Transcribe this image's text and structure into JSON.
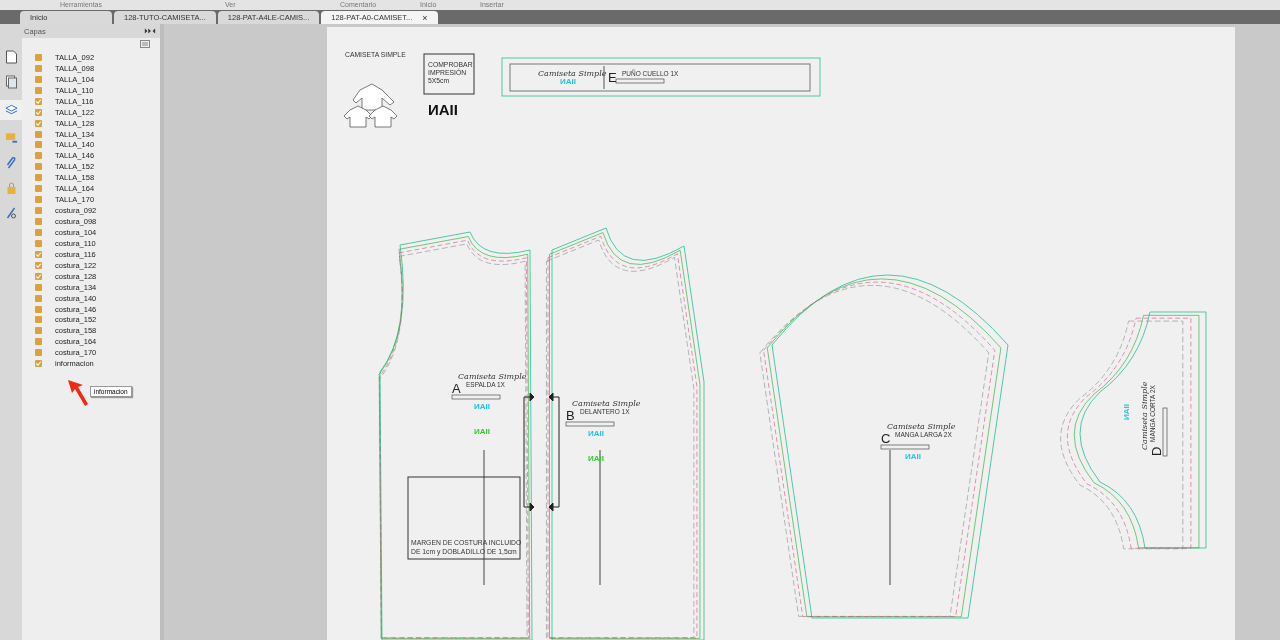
{
  "menu": [
    "Herramientas",
    "Ver",
    "Comentario",
    "Inicio",
    "Insertar"
  ],
  "tabs": [
    {
      "label": "Inicio",
      "selected": false
    },
    {
      "label": "128-TUTO-CAMISETA...",
      "selected": false
    },
    {
      "label": "128-PAT-A4LE-CAMIS...",
      "selected": false
    },
    {
      "label": "128-PAT-A0-CAMISET...",
      "selected": true
    }
  ],
  "tab_close": "×",
  "panel": {
    "title": "Capas",
    "layers": [
      {
        "name": "TALLA_092",
        "checked": false
      },
      {
        "name": "TALLA_098",
        "checked": false
      },
      {
        "name": "TALLA_104",
        "checked": false
      },
      {
        "name": "TALLA_110",
        "checked": false
      },
      {
        "name": "TALLA_116",
        "checked": true
      },
      {
        "name": "TALLA_122",
        "checked": true
      },
      {
        "name": "TALLA_128",
        "checked": true
      },
      {
        "name": "TALLA_134",
        "checked": false
      },
      {
        "name": "TALLA_140",
        "checked": false
      },
      {
        "name": "TALLA_146",
        "checked": false
      },
      {
        "name": "TALLA_152",
        "checked": false
      },
      {
        "name": "TALLA_158",
        "checked": false
      },
      {
        "name": "TALLA_164",
        "checked": false
      },
      {
        "name": "TALLA_170",
        "checked": false
      },
      {
        "name": "costura_092",
        "checked": false
      },
      {
        "name": "costura_098",
        "checked": false
      },
      {
        "name": "costura_104",
        "checked": false
      },
      {
        "name": "costura_110",
        "checked": false
      },
      {
        "name": "costura_116",
        "checked": true
      },
      {
        "name": "costura_122",
        "checked": true
      },
      {
        "name": "costura_128",
        "checked": true
      },
      {
        "name": "costura_134",
        "checked": false
      },
      {
        "name": "costura_140",
        "checked": false
      },
      {
        "name": "costura_146",
        "checked": false
      },
      {
        "name": "costura_152",
        "checked": false
      },
      {
        "name": "costura_158",
        "checked": false
      },
      {
        "name": "costura_164",
        "checked": false
      },
      {
        "name": "costura_170",
        "checked": false
      },
      {
        "name": "informacion",
        "checked": true
      }
    ],
    "tooltip": "informacion"
  },
  "document": {
    "header": {
      "title": "CAMISETA SIMPLE",
      "test_square": [
        "COMPROBAR",
        "IMPRESIÓN",
        "5X5cm"
      ],
      "logo": "ИAII"
    },
    "pieces": [
      {
        "script": "Camiseta Simple",
        "letter": "A",
        "name": "ESPALDA 1X",
        "logos": [
          {
            "text": "ИAII",
            "color": "#22c4e0"
          },
          {
            "text": "ИAII",
            "color": "#3cc43c"
          }
        ]
      },
      {
        "script": "Camiseta Simple",
        "letter": "B",
        "name": "DELANTERO 1X",
        "logos": [
          {
            "text": "ИAII",
            "color": "#22c4e0"
          },
          {
            "text": "ИAII",
            "color": "#3cc43c"
          }
        ]
      },
      {
        "script": "Camiseta Simple",
        "letter": "C",
        "name": "MANGA LARGA 2X",
        "logos": [
          {
            "text": "ИAII",
            "color": "#22c4e0"
          }
        ]
      },
      {
        "script": "Camiseta Simple",
        "letter": "D",
        "name": "MANGA CORTA 2X",
        "logos": [
          {
            "text": "ИAII",
            "color": "#22c4e0"
          }
        ]
      },
      {
        "script": "Camiseta Simple",
        "letter": "E",
        "name": "PUÑO CUELLO 1X",
        "logos": [
          {
            "text": "ИAII",
            "color": "#22c4e0"
          }
        ]
      }
    ],
    "legend": [
      "MARGEN DE COSTURA INCLUIDO",
      "DE 1cm y DOBLADILLO DE 1,5cm"
    ]
  }
}
